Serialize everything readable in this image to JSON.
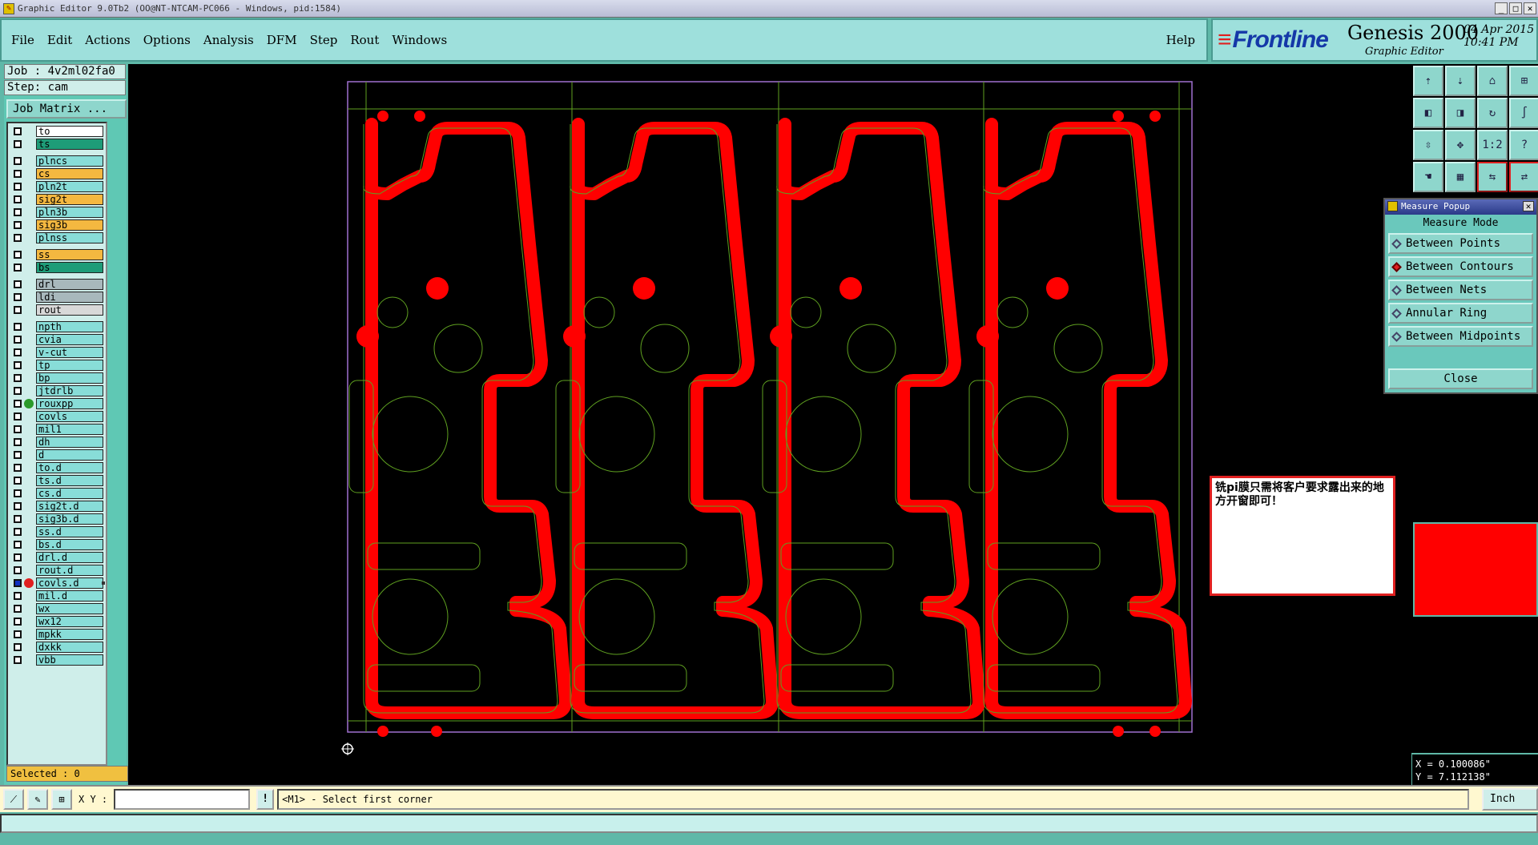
{
  "window_title": "Graphic Editor 9.0Tb2 (OO@NT-NTCAM-PC066 - Windows, pid:1584)",
  "menu": [
    "File",
    "Edit",
    "Actions",
    "Options",
    "Analysis",
    "DFM",
    "Step",
    "Rout",
    "Windows"
  ],
  "help": "Help",
  "brand": {
    "logo": "Frontline",
    "product": "Genesis 2000",
    "subtitle": "Graphic Editor",
    "date": "04 Apr 2015",
    "time": "10:41 PM"
  },
  "job": "Job : 4v2ml02fa0",
  "step": "Step: cam",
  "job_matrix": "Job Matrix ...",
  "layers": [
    {
      "name": "to",
      "color": "#ffffff",
      "group": 1
    },
    {
      "name": "ts",
      "color": "#1e9c78",
      "group": 1
    },
    {
      "name": "plncs",
      "color": "#88ddd8",
      "group": 2
    },
    {
      "name": "cs",
      "color": "#f4b840",
      "group": 2
    },
    {
      "name": "pln2t",
      "color": "#88ddd8",
      "group": 2
    },
    {
      "name": "sig2t",
      "color": "#f4b840",
      "group": 2
    },
    {
      "name": "pln3b",
      "color": "#88ddd8",
      "group": 2
    },
    {
      "name": "sig3b",
      "color": "#f4b840",
      "group": 2
    },
    {
      "name": "plnss",
      "color": "#88ddd8",
      "group": 2
    },
    {
      "name": "ss",
      "color": "#f4b840",
      "group": 3
    },
    {
      "name": "bs",
      "color": "#1e9c78",
      "group": 3
    },
    {
      "name": "drl",
      "color": "#a8b8bc",
      "group": 4
    },
    {
      "name": "ldi",
      "color": "#a8b8bc",
      "group": 4
    },
    {
      "name": "rout",
      "color": "#d8d8d8",
      "group": 4
    },
    {
      "name": "npth",
      "color": "#88ddd8",
      "group": 5
    },
    {
      "name": "cvia",
      "color": "#88ddd8",
      "group": 5
    },
    {
      "name": "v-cut",
      "color": "#88ddd8",
      "group": 5
    },
    {
      "name": "tp",
      "color": "#88ddd8",
      "group": 5
    },
    {
      "name": "bp",
      "color": "#88ddd8",
      "group": 5
    },
    {
      "name": "jtdrlb",
      "color": "#88ddd8",
      "group": 5
    },
    {
      "name": "rouxpp",
      "color": "#88ddd8",
      "group": 5,
      "dot": "#2a9a2a"
    },
    {
      "name": "covls",
      "color": "#88ddd8",
      "group": 5
    },
    {
      "name": "mil1",
      "color": "#88ddd8",
      "group": 5
    },
    {
      "name": "dh",
      "color": "#88ddd8",
      "group": 5
    },
    {
      "name": "d",
      "color": "#88ddd8",
      "group": 5
    },
    {
      "name": "to.d",
      "color": "#88ddd8",
      "group": 5
    },
    {
      "name": "ts.d",
      "color": "#88ddd8",
      "group": 5
    },
    {
      "name": "cs.d",
      "color": "#88ddd8",
      "group": 5
    },
    {
      "name": "sig2t.d",
      "color": "#88ddd8",
      "group": 5
    },
    {
      "name": "sig3b.d",
      "color": "#88ddd8",
      "group": 5
    },
    {
      "name": "ss.d",
      "color": "#88ddd8",
      "group": 5
    },
    {
      "name": "bs.d",
      "color": "#88ddd8",
      "group": 5
    },
    {
      "name": "drl.d",
      "color": "#88ddd8",
      "group": 5
    },
    {
      "name": "rout.d",
      "color": "#88ddd8",
      "group": 5
    },
    {
      "name": "covls.d",
      "color": "#88ddd8",
      "group": 5,
      "dot": "#e02020",
      "work": true
    },
    {
      "name": "mil.d",
      "color": "#88ddd8",
      "group": 5
    },
    {
      "name": "wx",
      "color": "#88ddd8",
      "group": 5
    },
    {
      "name": "wx12",
      "color": "#88ddd8",
      "group": 5
    },
    {
      "name": "mpkk",
      "color": "#88ddd8",
      "group": 5
    },
    {
      "name": "dxkk",
      "color": "#88ddd8",
      "group": 5
    },
    {
      "name": "vbb",
      "color": "#88ddd8",
      "group": 5
    }
  ],
  "selected": "Selected : 0",
  "tool_icons": [
    "layer-up-icon",
    "layer-down-icon",
    "home-icon",
    "split-view-icon",
    "pan-left-icon",
    "pan-right-icon",
    "rotate-icon",
    "snap-icon",
    "zoom-fit-icon",
    "zoom-center-icon",
    "ratio-icon",
    "help-icon",
    "hand-icon",
    "grid-icon",
    "measure-icon",
    "measure-alt-icon"
  ],
  "tool_labels": [
    "⇡",
    "⇣",
    "⌂",
    "⊞",
    "◧",
    "◨",
    "↻",
    "∫",
    "⇳",
    "✥",
    "1:2",
    "?",
    "☚",
    "▦",
    "⇆",
    "⇄"
  ],
  "measure_popup": {
    "title": "Measure Popup",
    "mode_header": "Measure Mode",
    "options": [
      "Between Points",
      "Between Contours",
      "Between Nets",
      "Annular Ring",
      "Between Midpoints"
    ],
    "selected": "Between Contours",
    "close": "Close"
  },
  "note": "铣pi膜只需将客户要求露出来的地方开窗即可！",
  "coords": {
    "x": "X = 0.100086\"",
    "y": "Y = 7.112138\""
  },
  "cmd": {
    "xy_label": "X Y :",
    "xy_value": "",
    "bang": "!",
    "prompt": "<M1> - Select first corner",
    "unit": "Inch"
  },
  "colors": {
    "canvas": "#000000",
    "copper": "#ff0000",
    "outline": "#5fa020",
    "panel_border": "#a070d0"
  }
}
